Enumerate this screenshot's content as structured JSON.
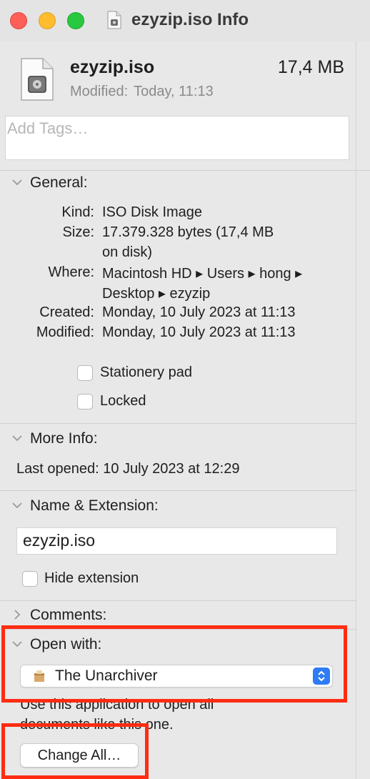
{
  "window": {
    "title": "ezyzip.iso Info"
  },
  "header": {
    "file_name": "ezyzip.iso",
    "file_size": "17,4 MB",
    "modified_label": "Modified:",
    "modified_value": "Today, 11:13",
    "tags_placeholder": "Add Tags…"
  },
  "general": {
    "title": "General:",
    "rows": [
      {
        "label": "Kind:",
        "value": "ISO Disk Image"
      },
      {
        "label": "Size:",
        "value_line1": "17.379.328 bytes (17,4 MB",
        "value_line2": "on disk)"
      },
      {
        "label": "Where:",
        "value_line1": "Macintosh HD ▸ Users ▸ hong ▸",
        "value_line2": "Desktop ▸ ezyzip"
      },
      {
        "label": "Created:",
        "value": "Monday, 10 July 2023 at 11:13"
      },
      {
        "label": "Modified:",
        "value": "Monday, 10 July 2023 at 11:13"
      }
    ],
    "stationery_label": "Stationery pad",
    "locked_label": "Locked"
  },
  "more_info": {
    "title": "More Info:",
    "last_opened": "Last opened: 10 July 2023 at 12:29"
  },
  "name_extension": {
    "title": "Name & Extension:",
    "name_value": "ezyzip.iso",
    "hide_extension_label": "Hide extension"
  },
  "comments": {
    "title": "Comments:"
  },
  "open_with": {
    "title": "Open with:",
    "selected_app": "The Unarchiver",
    "help_text": "Use this application to open all documents like this one.",
    "change_all_label": "Change All…"
  },
  "colors": {
    "highlight": "#ff2d12",
    "accent": "#2e7cf6"
  }
}
